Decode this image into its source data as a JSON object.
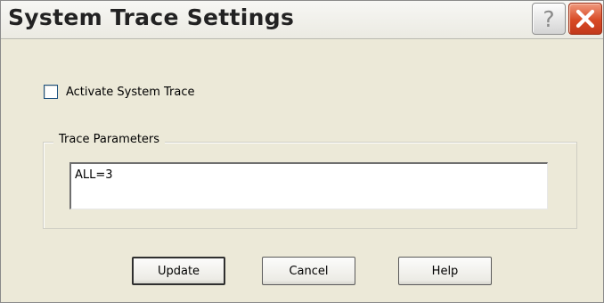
{
  "window": {
    "title": "System Trace Settings"
  },
  "titlebar": {
    "help_glyph": "?",
    "help_icon": "question-mark-icon",
    "close_icon": "close-x-icon"
  },
  "activate": {
    "label": "Activate System Trace",
    "checked": false
  },
  "trace_parameters": {
    "group_label": "Trace Parameters",
    "value": "ALL=3"
  },
  "buttons": {
    "update": "Update",
    "cancel": "Cancel",
    "help": "Help"
  },
  "colors": {
    "dialog_bg": "#ece9d8",
    "close_button": "#d84a25"
  }
}
